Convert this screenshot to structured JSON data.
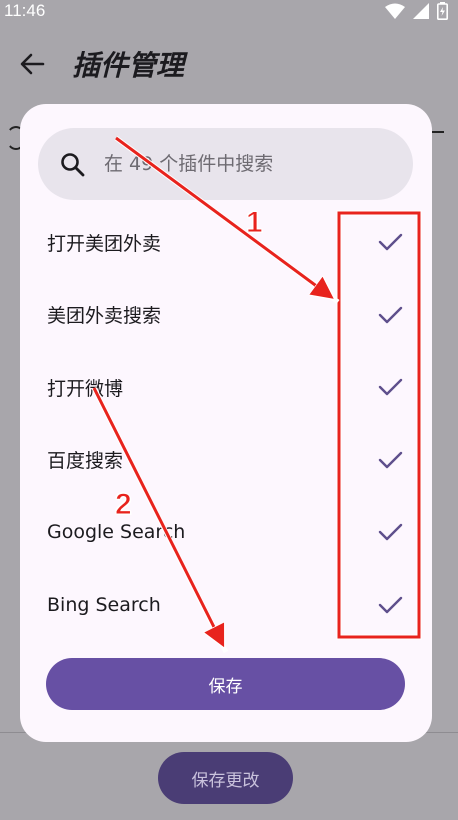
{
  "status_bar": {
    "time": "11:46"
  },
  "header": {
    "title": "插件管理"
  },
  "search": {
    "placeholder": "在 49 个插件中搜索"
  },
  "plugins": [
    {
      "label": "打开美团外卖",
      "checked": true
    },
    {
      "label": "美团外卖搜索",
      "checked": true
    },
    {
      "label": "打开微博",
      "checked": true
    },
    {
      "label": "百度搜索",
      "checked": true
    },
    {
      "label": "Google Search",
      "checked": true
    },
    {
      "label": "Bing Search",
      "checked": true
    }
  ],
  "dialog": {
    "save_label": "保存"
  },
  "footer": {
    "save_changes_label": "保存更改"
  },
  "annotations": {
    "marker_1": "1",
    "marker_2": "2"
  },
  "colors": {
    "accent": "#6750a4",
    "check": "#5e4f8c",
    "annotation": "#e8231d",
    "save_changes_bg": "#4a3d75"
  }
}
